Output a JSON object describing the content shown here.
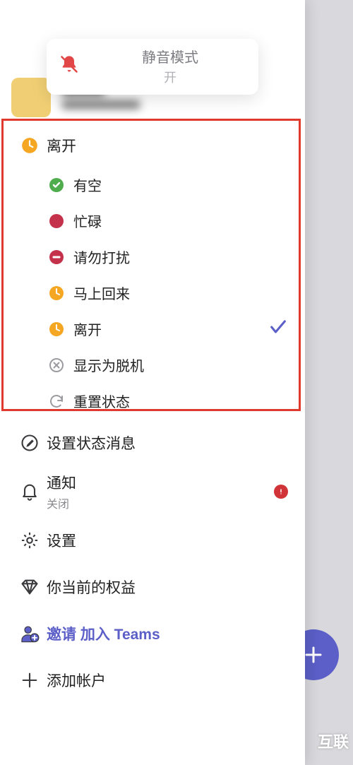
{
  "toast": {
    "title": "静音模式",
    "sub": "开"
  },
  "current_status": "离开",
  "status_options": {
    "available": "有空",
    "busy": "忙碌",
    "dnd": "请勿打扰",
    "brb": "马上回来",
    "away": "离开",
    "offline": "显示为脱机",
    "reset": "重置状态"
  },
  "selected_status_key": "away",
  "menu": {
    "set_status_message": "设置状态消息",
    "notifications": {
      "label": "通知",
      "state": "关闭"
    },
    "settings": "设置",
    "benefits": "你当前的权益",
    "invite": "邀请 加入 Teams",
    "add_account": "添加帐户"
  },
  "watermark": "互联"
}
